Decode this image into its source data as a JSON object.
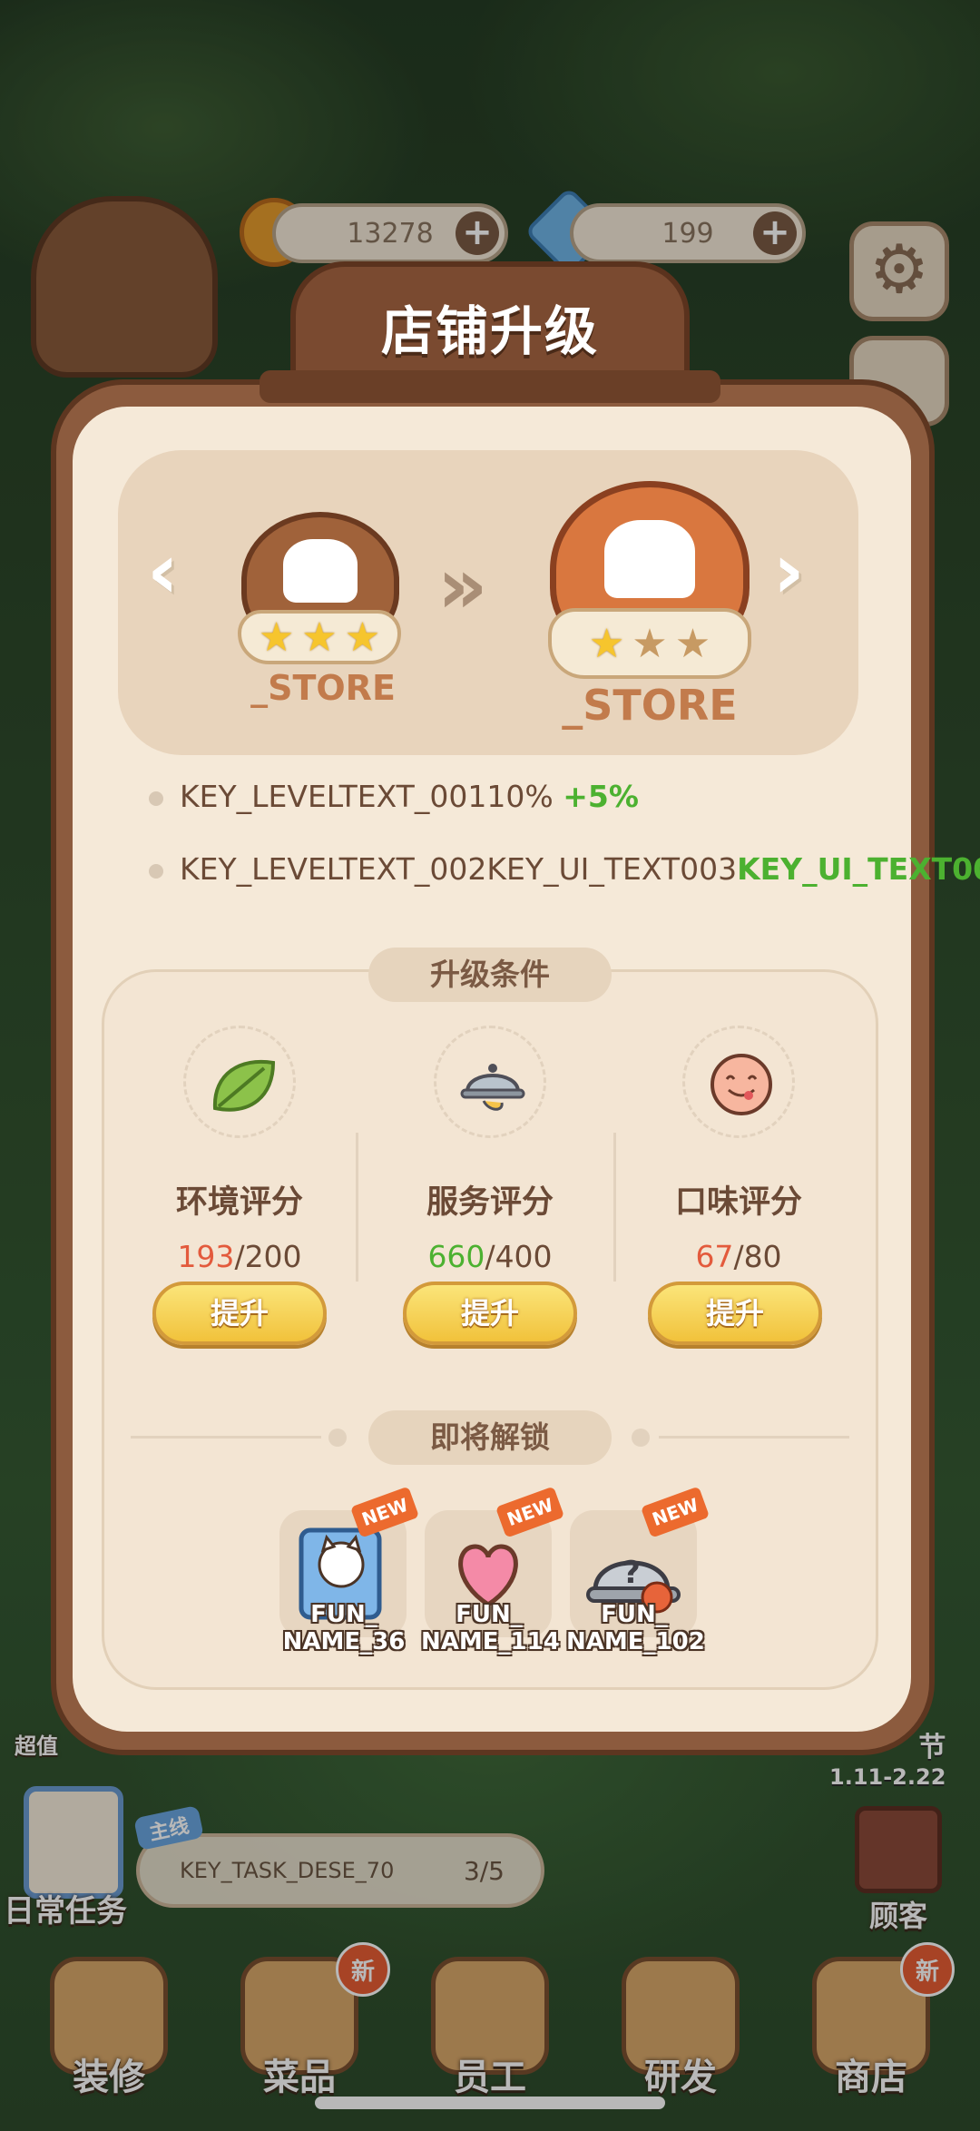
{
  "hud": {
    "coins": "13278",
    "gems": "199",
    "plus": "+",
    "gear_glyph": "⚙",
    "side_text_left": "超值",
    "festival": "节",
    "festival_dates": "1.11-2.22"
  },
  "task": {
    "tag": "主线",
    "daily_label": "日常任务",
    "text": "KEY_TASK_DESE_70",
    "progress": "3/5"
  },
  "customer_label": "顾客",
  "nav": [
    {
      "label": "装修",
      "new": false
    },
    {
      "label": "菜品",
      "new": true
    },
    {
      "label": "员工",
      "new": false
    },
    {
      "label": "研发",
      "new": false
    },
    {
      "label": "商店",
      "new": true
    }
  ],
  "nav_new_label": "新",
  "modal": {
    "title": "店铺升级",
    "current": {
      "label": "_STORE",
      "stars_filled": 3
    },
    "next": {
      "label": "_STORE",
      "stars_filled": 1
    },
    "arrow_left": "‹",
    "arrow_right": "›",
    "double_arrow": "»",
    "info1": {
      "key": "KEY_LEVELTEXT_001",
      "value": "10%",
      "bonus": "+5%"
    },
    "info2": {
      "key": "KEY_LEVELTEXT_002",
      "value": "KEY_UI_TEXT003",
      "bonus": "KEY_UI_TEXT00"
    },
    "conditions_title": "升级条件",
    "conditions": [
      {
        "name": "环境评分",
        "current": "193",
        "sep": "/",
        "target": "200",
        "status": "low",
        "icon": "leaf-icon",
        "button": "提升"
      },
      {
        "name": "服务评分",
        "current": "660",
        "sep": "/",
        "target": "400",
        "status": "ok",
        "icon": "cloche-icon",
        "button": "提升"
      },
      {
        "name": "口味评分",
        "current": "67",
        "sep": "/",
        "target": "80",
        "status": "low",
        "icon": "yummy-face-icon",
        "button": "提升"
      }
    ],
    "unlock_title": "即将解锁",
    "unlocks": [
      {
        "name1": "FUN_",
        "name2": "NAME_36",
        "icon": "cat-book-icon",
        "tag": "NEW"
      },
      {
        "name1": "FUN_",
        "name2": "NAME_114",
        "icon": "heart-icon",
        "tag": "NEW"
      },
      {
        "name1": "FUN_",
        "name2": "NAME_102",
        "icon": "mystery-dish-icon",
        "tag": "NEW"
      }
    ]
  },
  "colors": {
    "low": "#e35a3c",
    "ok": "#4cb130",
    "frame": "#8c5b3e",
    "panel": "#f5e9d8"
  }
}
